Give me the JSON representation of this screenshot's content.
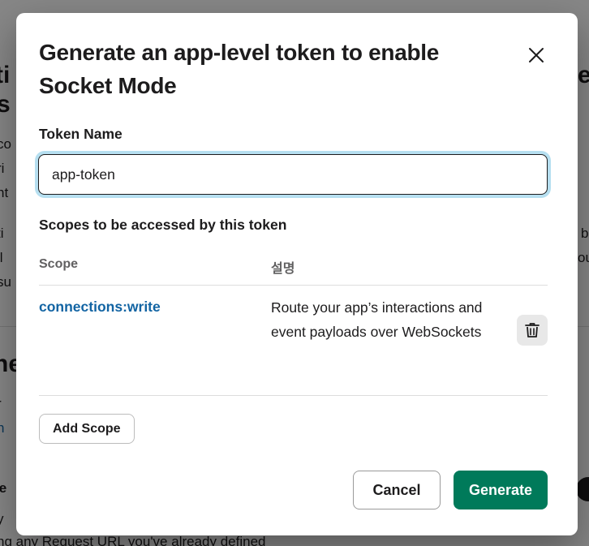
{
  "background": {
    "fragments": [
      "ti",
      "es",
      "s",
      "co",
      "ri",
      "nt",
      "ti",
      "b",
      "ll",
      "ou",
      "su",
      "ne",
      "r",
      "n",
      "le",
      "y",
      "ng any Request URL you've already defined"
    ]
  },
  "modal": {
    "title": "Generate an app-level token to enable Socket Mode",
    "token_field": {
      "label": "Token Name",
      "value": "app-token"
    },
    "scopes_section": {
      "label": "Scopes to be accessed by this token",
      "columns": [
        "Scope",
        "설명"
      ],
      "rows": [
        {
          "scope": "connections:write",
          "description": "Route your app’s interactions and event payloads over WebSockets"
        }
      ]
    },
    "add_scope_label": "Add Scope",
    "cancel_label": "Cancel",
    "generate_label": "Generate"
  },
  "icons": {
    "close": "close-icon",
    "delete": "trash-icon"
  },
  "colors": {
    "link": "#1264a3",
    "primary_button": "#007a5a",
    "focus_ring": "#1d9bd1",
    "text": "#1d1c1d"
  }
}
